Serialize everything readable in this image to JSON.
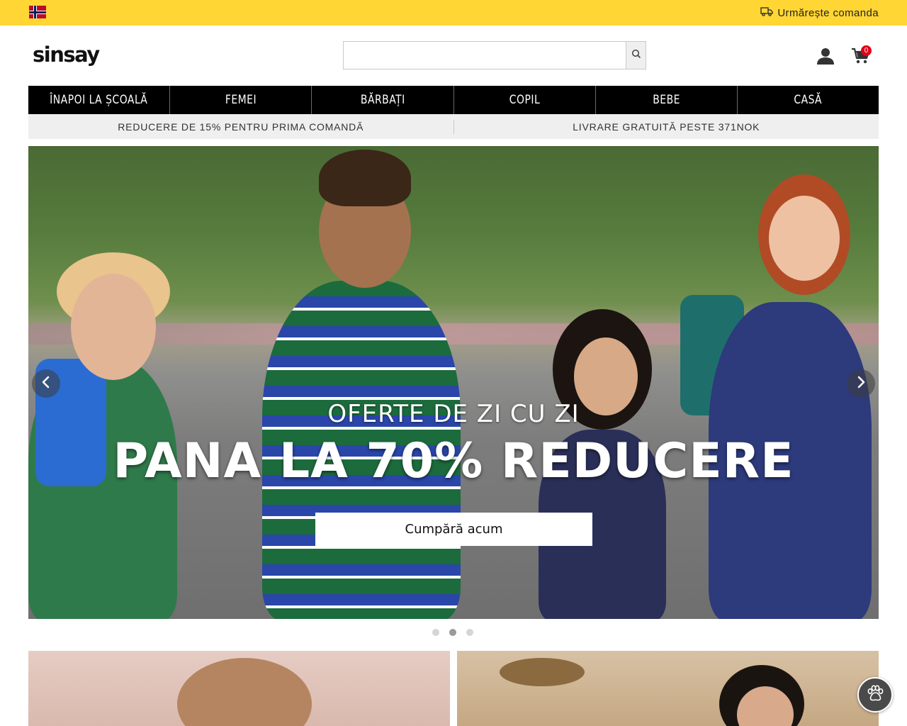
{
  "topbar": {
    "flag_icon": "norway-flag-icon",
    "track_icon": "truck-icon",
    "track_label": "Urmărește comanda",
    "background": "#ffd633"
  },
  "header": {
    "logo_text": "sinsay",
    "search": {
      "value": "",
      "placeholder": ""
    },
    "search_icon": "search-icon",
    "account_icon": "user-icon",
    "cart_icon": "cart-icon",
    "cart_count": "0"
  },
  "nav": {
    "items": [
      {
        "label": "ÎNAPOI LA ȘCOALĂ"
      },
      {
        "label": "FEMEI"
      },
      {
        "label": "BĂRBAȚI"
      },
      {
        "label": "COPIL"
      },
      {
        "label": "BEBE"
      },
      {
        "label": "CASĂ"
      }
    ]
  },
  "promo": {
    "left": "REDUCERE DE 15% PENTRU PRIMA COMANDĂ",
    "right": "LIVRARE GRATUITĂ PESTE 371NOK"
  },
  "hero": {
    "subtitle": "OFERTE DE ZI CU ZI",
    "title": "PANA LA 70% REDUCERE",
    "cta": "Cumpără acum",
    "prev_icon": "chevron-left-icon",
    "next_icon": "chevron-right-icon",
    "slides": 3,
    "active_slide": 2
  },
  "widget": {
    "icon": "paw-icon"
  },
  "colors": {
    "accent": "#ffd633",
    "nav_bg": "#000000",
    "badge": "#e2001a"
  }
}
